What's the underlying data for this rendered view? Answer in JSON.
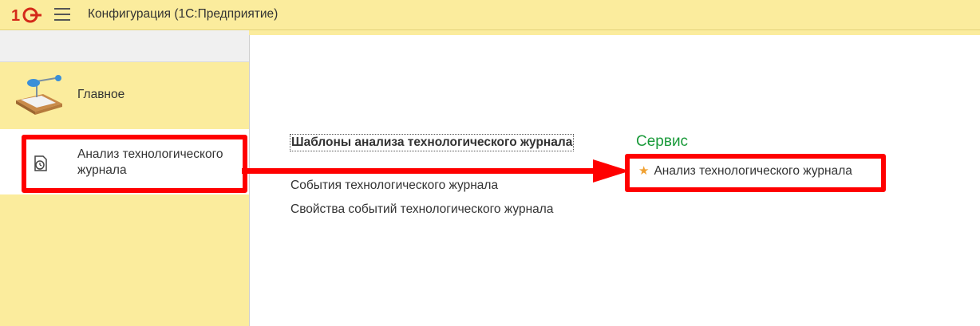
{
  "header": {
    "app_title": "Конфигурация  (1С:Предприятие)"
  },
  "sidebar": {
    "items": [
      {
        "label": "Главное",
        "icon": "desk-lamp-icon"
      },
      {
        "label": "Анализ технологического журнала",
        "icon": "clock-document-icon",
        "selected": true
      }
    ]
  },
  "content": {
    "section_title": "Шаблоны анализа технологического журнала",
    "links": [
      "События технологического журнала",
      "Свойства событий технологического журнала"
    ],
    "service": {
      "title": "Сервис",
      "favorite_item": "Анализ технологического журнала"
    }
  },
  "colors": {
    "panel_bg": "#fbec9d",
    "accent_green": "#1a9a3a",
    "highlight_red": "#ff0000",
    "star": "#f0a030"
  }
}
